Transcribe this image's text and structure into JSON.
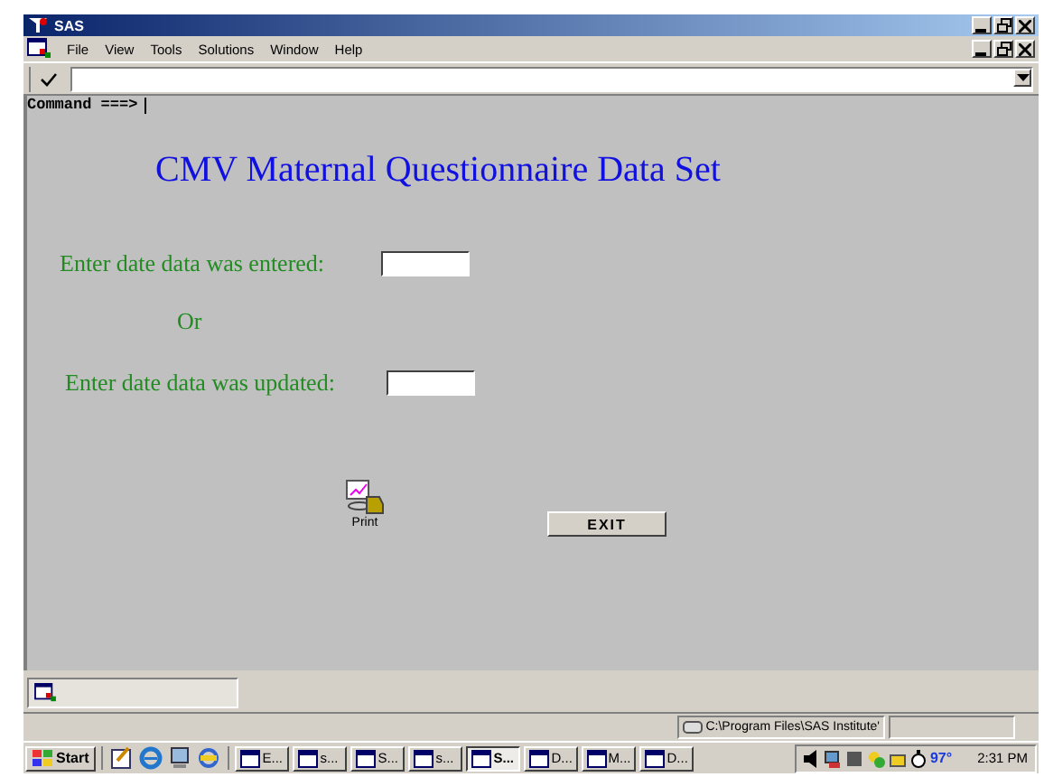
{
  "window": {
    "title": "SAS"
  },
  "menu": [
    "File",
    "View",
    "Tools",
    "Solutions",
    "Window",
    "Help"
  ],
  "command": {
    "label": "Command ===>"
  },
  "form": {
    "title": "CMV Maternal Questionnaire Data Set",
    "fields": [
      {
        "label": "Enter date data was entered:"
      },
      {
        "label": "Enter date data was updated:"
      }
    ],
    "separator": "Or",
    "print_label": "Print",
    "exit_button": "EXIT"
  },
  "status_bar": {
    "path": "C:\\Program Files\\SAS Institute'"
  },
  "taskbar": {
    "start": "Start",
    "tasks": [
      {
        "label": "E...",
        "selected": false
      },
      {
        "label": "s...",
        "selected": false
      },
      {
        "label": "S...",
        "selected": false
      },
      {
        "label": "s...",
        "selected": false
      },
      {
        "label": "S...",
        "selected": true
      },
      {
        "label": "D...",
        "selected": false
      },
      {
        "label": "M...",
        "selected": false
      },
      {
        "label": "D...",
        "selected": false
      }
    ],
    "temperature": "97°",
    "clock": "2:31 PM"
  }
}
